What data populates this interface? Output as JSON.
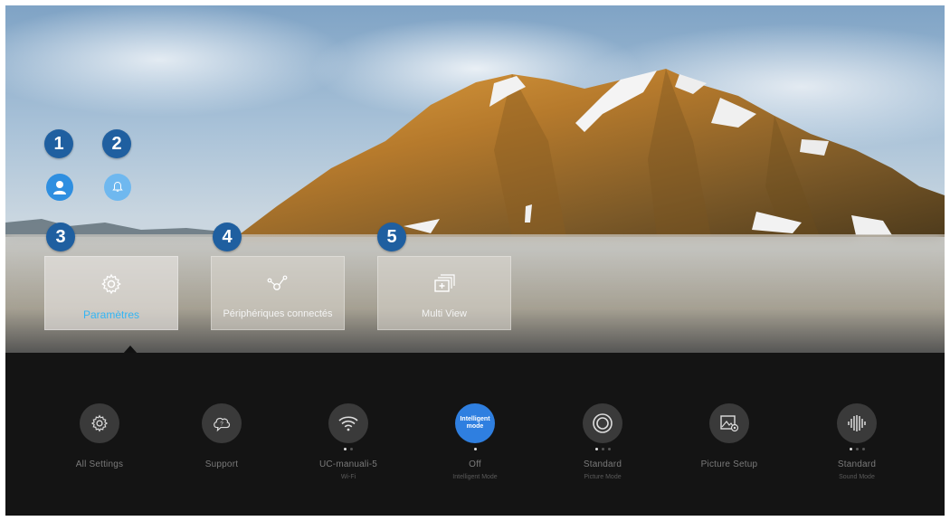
{
  "markers": [
    "1",
    "2",
    "3",
    "4",
    "5"
  ],
  "header": {
    "profile_icon": "profile-icon",
    "notification_icon": "bell-icon"
  },
  "tiles": [
    {
      "label": "Paramètres",
      "icon": "gear-icon",
      "selected": true
    },
    {
      "label": "Périphériques connectés",
      "icon": "connected-devices-icon",
      "selected": false
    },
    {
      "label": "Multi View",
      "icon": "multi-view-icon",
      "selected": false
    }
  ],
  "quick_settings": [
    {
      "label": "All Settings",
      "sub": "",
      "icon": "gear-icon"
    },
    {
      "label": "Support",
      "sub": "",
      "icon": "support-icon"
    },
    {
      "label": "UC-manuali-5",
      "sub": "Wi-Fi",
      "icon": "wifi-icon"
    },
    {
      "label": "Off",
      "sub": "Intelligent Mode",
      "icon": "intelligent-mode-icon",
      "badge_line1": "Intelligent",
      "badge_line2": "mode"
    },
    {
      "label": "Standard",
      "sub": "Picture Mode",
      "icon": "picture-mode-icon"
    },
    {
      "label": "Picture Setup",
      "sub": "",
      "icon": "picture-setup-icon"
    },
    {
      "label": "Standard",
      "sub": "Sound Mode",
      "icon": "sound-mode-icon"
    }
  ],
  "colors": {
    "marker": "#1f5fa0",
    "selected_label": "#33b5f5",
    "active_quick": "#2f7fe0",
    "bar": "#141414"
  }
}
